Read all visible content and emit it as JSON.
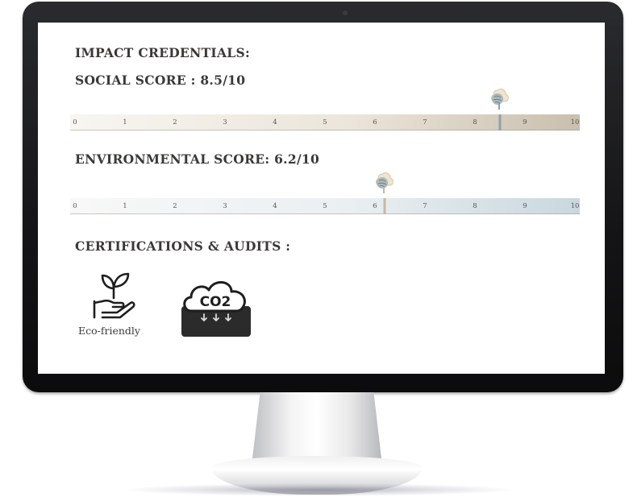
{
  "impact": {
    "title": "IMPACT CREDENTIALS:",
    "social_heading": "SOCIAL SCORE : 8.5/10",
    "environmental_heading": "ENVIRONMENTAL SCORE: 6.2/10",
    "certifications_heading": "CERTIFICATIONS & AUDITS :"
  },
  "scores": {
    "social": {
      "value": 8.5,
      "max": 10
    },
    "environmental": {
      "value": 6.2,
      "max": 10
    }
  },
  "scale_ticks": [
    "0",
    "1",
    "2",
    "3",
    "4",
    "5",
    "6",
    "7",
    "8",
    "9",
    "10"
  ],
  "certifications": [
    {
      "label": "Eco-friendly",
      "icon": "plant-in-hand-icon"
    },
    {
      "label": "",
      "icon": "co2-cloud-icon",
      "badge_text": "CO2"
    }
  ],
  "colors": {
    "heading": "#3b3937",
    "social_marker": "#8fa1a8",
    "env_marker": "#c8b6a2"
  }
}
